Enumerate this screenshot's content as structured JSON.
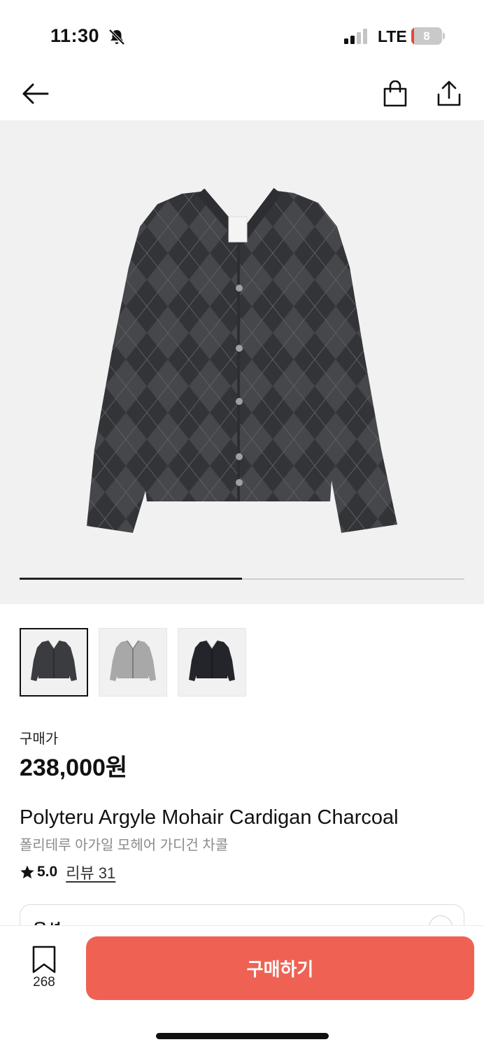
{
  "status_bar": {
    "time": "11:30",
    "network": "LTE",
    "battery_level": "8",
    "battery_fraction": 0.08,
    "battery_color": "#e7473b",
    "icons": [
      "bell-slash-icon",
      "cellular-signal-icon"
    ]
  },
  "nav": {
    "icons": [
      "arrow-left-icon",
      "shopping-bag-icon",
      "share-icon"
    ]
  },
  "gallery": {
    "progress_fraction": 0.5,
    "thumbnails": [
      {
        "name": "charcoal",
        "color": "#3b3c40",
        "selected": true
      },
      {
        "name": "grey",
        "color": "#a8a8a8",
        "selected": false
      },
      {
        "name": "black",
        "color": "#24252a",
        "selected": false
      }
    ]
  },
  "product": {
    "price_label": "구매가",
    "price": "238,000원",
    "name_en": "Polyteru Argyle Mohair Cardigan Charcoal",
    "name_ko": "폴리테루 아가일 모헤어 가디건 차콜",
    "rating": "5.0",
    "review_link": "리뷰 31"
  },
  "option": {
    "label": "옵션"
  },
  "bottom_bar": {
    "bookmark_count": "268",
    "buy_label": "구매하기",
    "accent_color": "#ef6253"
  }
}
